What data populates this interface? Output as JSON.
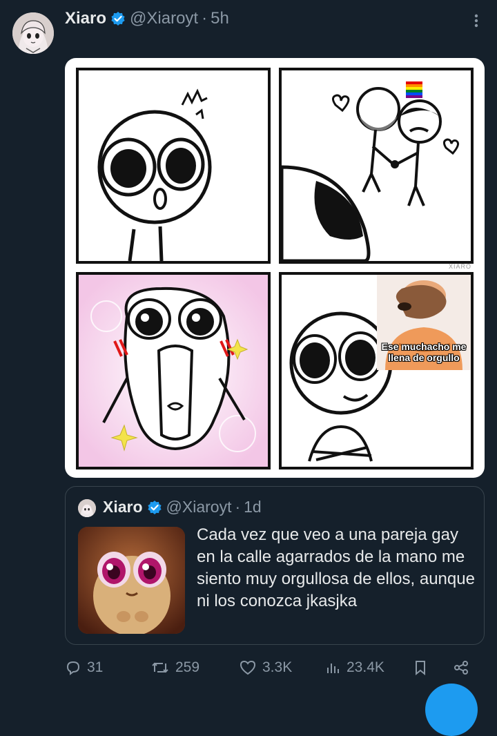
{
  "tweet": {
    "author_name": "Xiaro",
    "handle": "@Xiaroyt",
    "separator": "·",
    "time": "5h",
    "media_watermark": "XIARO",
    "meme_caption": "Ese muchacho me llena de orgullo"
  },
  "quoted": {
    "author_name": "Xiaro",
    "handle": "@Xiaroyt",
    "separator": "·",
    "time": "1d",
    "text": "Cada vez que veo a una pareja gay en la calle agarrados de la mano me siento muy orgullosa de ellos, aunque ni los conozca jkasjka"
  },
  "actions": {
    "replies": "31",
    "retweets": "259",
    "likes": "3.3K",
    "views": "23.4K"
  },
  "colors": {
    "background": "#15202b",
    "text_primary": "#e7e9ea",
    "text_secondary": "#8b98a5",
    "verified": "#1d9bf0",
    "border": "#38444d"
  }
}
